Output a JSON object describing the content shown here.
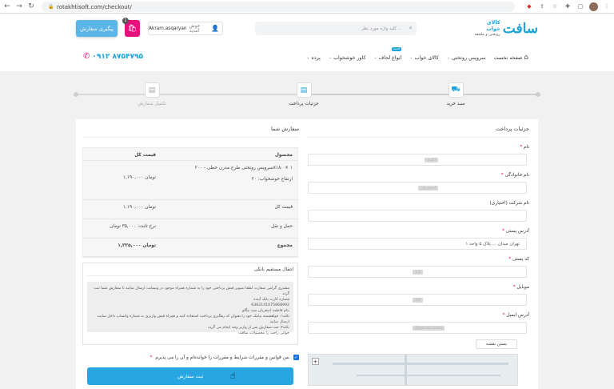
{
  "browser": {
    "url": "rotakhtisoft.com/checkout/"
  },
  "header": {
    "order_tracking": "پیگیری سفارش",
    "cart_count": "1",
    "greeting": "خوش آمدید",
    "username": "Akram.asqaryan",
    "search_placeholder": "کلید واژه مورد نظر ...",
    "logo_mark": "سافت",
    "logo_line1": "کالای خواب",
    "logo_line2": "روتختی و ملحفه",
    "phone": "۰۹۱۲ ۸۷۵۴۷۹۵",
    "menu": [
      {
        "label": "صفحه نخست"
      },
      {
        "label": "سرویس روتختی"
      },
      {
        "label": "کالای خواب"
      },
      {
        "label": "انواع لحاف",
        "badge": "جدید"
      },
      {
        "label": "کاور خوشخواب"
      },
      {
        "label": "پرده"
      }
    ]
  },
  "steps": [
    {
      "label": "سبد خرید"
    },
    {
      "label": "جزئیات پرداخت"
    },
    {
      "label": "تکمیل سفارش"
    }
  ],
  "order": {
    "title": "سفارش شما",
    "head_product": "محصول",
    "head_total": "قیمت کل",
    "product_name": "سرویس روتختی طرح مدرن خطی - ۲۰۰x۱۸۰",
    "product_qty": "× ۱",
    "product_attr": "ارتفاع خوشخواب: ۲۰",
    "product_price": "۱,۱۹۰,۰۰۰ تومان",
    "subtotal_label": "قیمت کل",
    "subtotal_value": "۱,۱۹۰,۰۰۰ تومان",
    "shipping_label": "حمل و نقل",
    "shipping_value": "نرخ ثابت: ۳۵,۰۰۰ تومان",
    "total_label": "مجموع",
    "total_value": "۱,۲۲۵,۰۰۰ تومان"
  },
  "bank": {
    "title": "انتقال مستقیم بانکی",
    "line1": "مشتری گرامی سفارت لطفا تصویر فیش پرداختی خود را به شماره همراه موجود در وبسایت ارسال نمایید تا سفارش شما ثبت گردد",
    "line2": "شماره کارت بانک آینده",
    "line3": "6362141075868992",
    "line4": "بنام فاطمه اصغریان سید بیگلو",
    "line5": "نکته۱: خواهشمند پیامک خود را بعنوان کد رهگیری پرداخت استفاده کنید و همراه فیش واریزی به شماره واتساپ داخل سایت ارسال نمایید",
    "line6": "نکته۲: ثبت سفارش پس از واریز وجه انجام می گردد",
    "line7": "خوانی راحت را محصولات سافت"
  },
  "terms": {
    "label": "من قوانین و مقررات شرایط و مقررات را خوانده‌ام و آن را می پذیرم."
  },
  "submit_label": "ثبت سفارش",
  "billing": {
    "title": "جزئیات پرداخت",
    "first_name_label": "نام",
    "first_name_value": "اکرم",
    "last_name_label": "نام خانوادگی",
    "last_name_value": "اصغریان",
    "company_label": "نام شرکت (اختیاری)",
    "address_label": "آدرس پستی",
    "address_value": "تهران میدان ... پلاک ۵ واحد ۱",
    "postcode_label": "کد پستی",
    "postcode_value": "13",
    "mobile_label": "موبایل",
    "mobile_value": "35",
    "email_label": "آدرس ایمیل",
    "email_value": "@gmail.com",
    "map_button": "بستن نقشه"
  }
}
